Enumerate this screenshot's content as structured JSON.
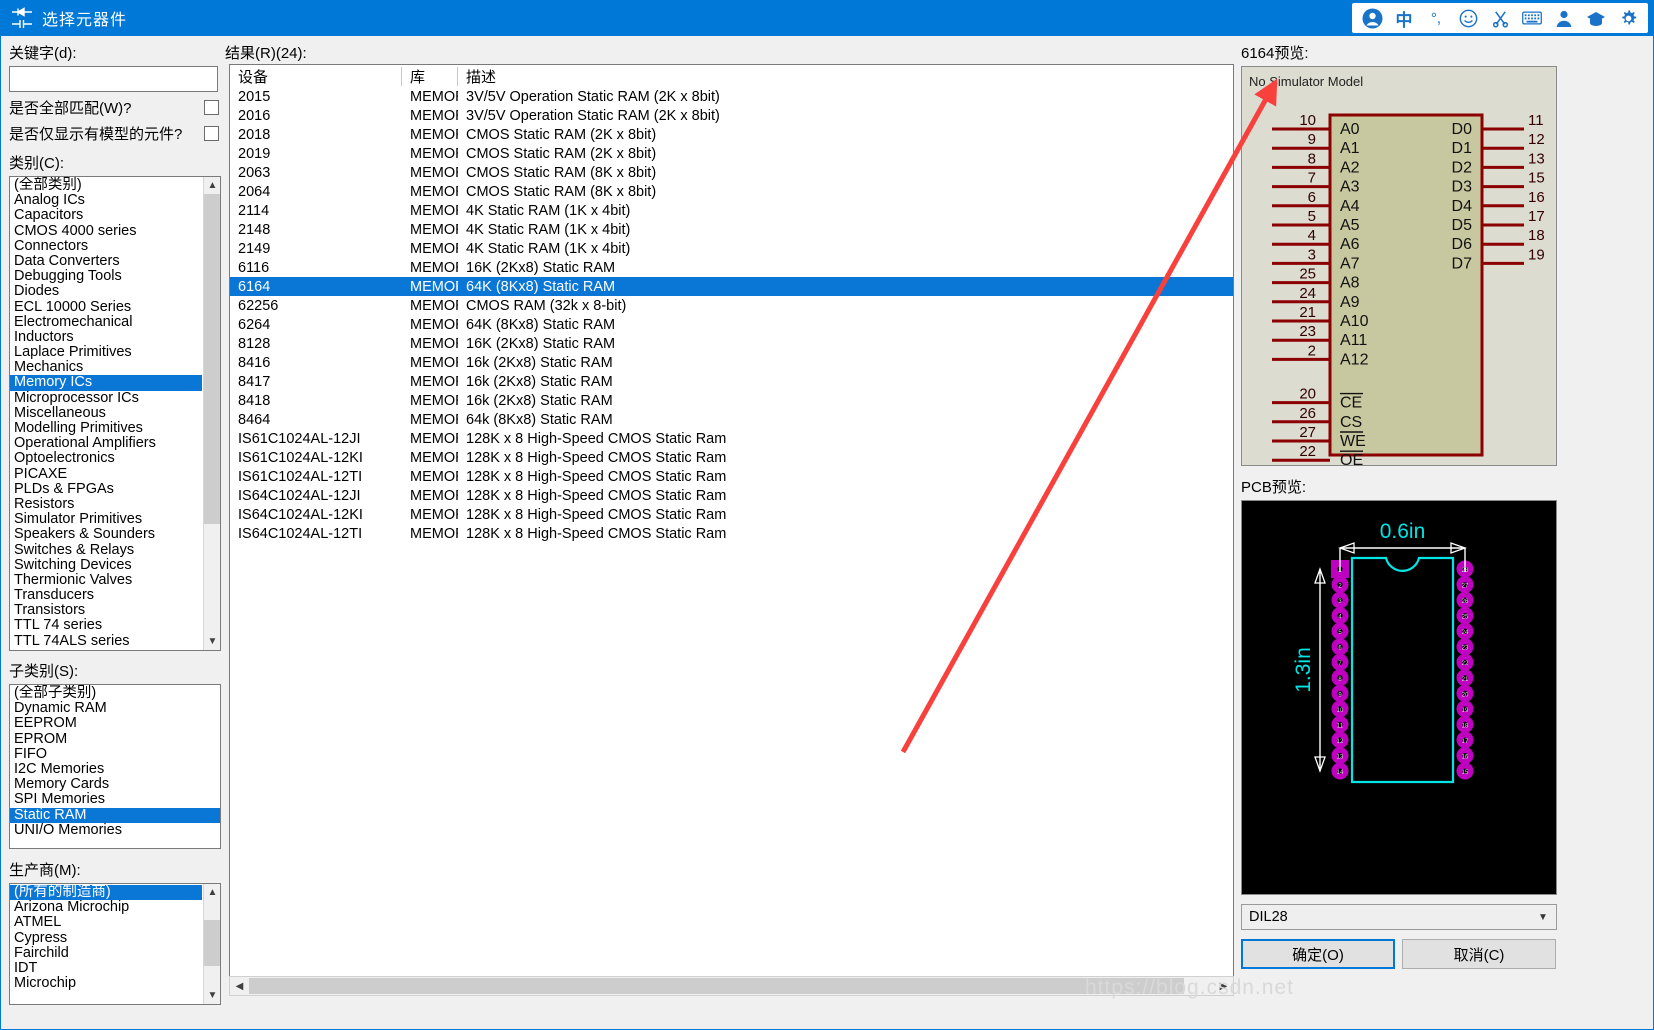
{
  "titlebar": {
    "title": "选择元器件",
    "app_icon": "component-icon",
    "ime_icons": [
      "user-avatar-icon",
      "chinese-input-icon",
      "punctuation-icon",
      "emoji-icon",
      "scissors-icon",
      "keyboard-icon",
      "person-icon",
      "hat-icon",
      "gear-icon"
    ],
    "accent_color": "#0078d7"
  },
  "left": {
    "keyword_label": "关键字(d):",
    "keyword_value": "",
    "keyword_placeholder": "",
    "match_all_label": "是否全部匹配(W)?",
    "match_all_checked": false,
    "only_modelled_label": "是否仅显示有模型的元件?",
    "only_modelled_checked": false,
    "category_label": "类别(C):",
    "categories": [
      "(全部类别)",
      "Analog ICs",
      "Capacitors",
      "CMOS 4000 series",
      "Connectors",
      "Data Converters",
      "Debugging Tools",
      "Diodes",
      "ECL 10000 Series",
      "Electromechanical",
      "Inductors",
      "Laplace Primitives",
      "Mechanics",
      "Memory ICs",
      "Microprocessor ICs",
      "Miscellaneous",
      "Modelling Primitives",
      "Operational Amplifiers",
      "Optoelectronics",
      "PICAXE",
      "PLDs & FPGAs",
      "Resistors",
      "Simulator Primitives",
      "Speakers & Sounders",
      "Switches & Relays",
      "Switching Devices",
      "Thermionic Valves",
      "Transducers",
      "Transistors",
      "TTL 74 series",
      "TTL 74ALS series"
    ],
    "category_selected": "Memory ICs",
    "subcategory_label": "子类别(S):",
    "subcategories": [
      "(全部子类别)",
      "Dynamic RAM",
      "EEPROM",
      "EPROM",
      "FIFO",
      "I2C Memories",
      "Memory Cards",
      "SPI Memories",
      "Static RAM",
      "UNI/O Memories"
    ],
    "subcategory_selected": "Static RAM",
    "manufacturer_label": "生产商(M):",
    "manufacturers": [
      "(所有的制造商)",
      "Arizona Microchip",
      "ATMEL",
      "Cypress",
      "Fairchild",
      "IDT",
      "Microchip"
    ],
    "manufacturer_selected": "(所有的制造商)"
  },
  "results": {
    "label": "结果(R)(24):",
    "count": 24,
    "columns": [
      "设备",
      "库",
      "描述"
    ],
    "selected_device": "6164",
    "rows": [
      {
        "device": "2015",
        "library": "MEMORY",
        "description": "3V/5V Operation Static RAM (2K x 8bit)"
      },
      {
        "device": "2016",
        "library": "MEMORY",
        "description": "3V/5V Operation Static RAM (2K x 8bit)"
      },
      {
        "device": "2018",
        "library": "MEMORY",
        "description": "CMOS Static RAM (2K x 8bit)"
      },
      {
        "device": "2019",
        "library": "MEMORY",
        "description": "CMOS Static RAM (2K x 8bit)"
      },
      {
        "device": "2063",
        "library": "MEMORY",
        "description": "CMOS Static RAM (8K x 8bit)"
      },
      {
        "device": "2064",
        "library": "MEMORY",
        "description": "CMOS Static RAM (8K x 8bit)"
      },
      {
        "device": "2114",
        "library": "MEMORY",
        "description": "4K Static RAM (1K x 4bit)"
      },
      {
        "device": "2148",
        "library": "MEMORY",
        "description": "4K Static RAM (1K x 4bit)"
      },
      {
        "device": "2149",
        "library": "MEMORY",
        "description": "4K Static RAM (1K x 4bit)"
      },
      {
        "device": "6116",
        "library": "MEMORY",
        "description": "16K (2Kx8) Static RAM"
      },
      {
        "device": "6164",
        "library": "MEMORY",
        "description": "64K (8Kx8) Static RAM"
      },
      {
        "device": "62256",
        "library": "MEMORY",
        "description": "CMOS RAM (32k x 8-bit)"
      },
      {
        "device": "6264",
        "library": "MEMORY",
        "description": "64K (8Kx8) Static RAM"
      },
      {
        "device": "8128",
        "library": "MEMORY",
        "description": "16K (2Kx8) Static RAM"
      },
      {
        "device": "8416",
        "library": "MEMORY",
        "description": "16k (2Kx8) Static RAM"
      },
      {
        "device": "8417",
        "library": "MEMORY",
        "description": "16k (2Kx8) Static RAM"
      },
      {
        "device": "8418",
        "library": "MEMORY",
        "description": "16k (2Kx8) Static RAM"
      },
      {
        "device": "8464",
        "library": "MEMORY",
        "description": "64k (8Kx8) Static RAM"
      },
      {
        "device": "IS61C1024AL-12JI",
        "library": "MEMORY",
        "description": "128K x 8 High-Speed CMOS Static Ram"
      },
      {
        "device": "IS61C1024AL-12KI",
        "library": "MEMORY",
        "description": "128K x 8 High-Speed CMOS Static Ram"
      },
      {
        "device": "IS61C1024AL-12TI",
        "library": "MEMORY",
        "description": "128K x 8 High-Speed CMOS Static Ram"
      },
      {
        "device": "IS64C1024AL-12JI",
        "library": "MEMORY",
        "description": "128K x 8 High-Speed CMOS Static Ram"
      },
      {
        "device": "IS64C1024AL-12KI",
        "library": "MEMORY",
        "description": "128K x 8 High-Speed CMOS Static Ram"
      },
      {
        "device": "IS64C1024AL-12TI",
        "library": "MEMORY",
        "description": "128K x 8 High-Speed CMOS Static Ram"
      }
    ]
  },
  "preview": {
    "schematic_label": "6164预览:",
    "no_model_text": "No Simulator Model",
    "left_pins": [
      {
        "num": "10",
        "name": "A0"
      },
      {
        "num": "9",
        "name": "A1"
      },
      {
        "num": "8",
        "name": "A2"
      },
      {
        "num": "7",
        "name": "A3"
      },
      {
        "num": "6",
        "name": "A4"
      },
      {
        "num": "5",
        "name": "A5"
      },
      {
        "num": "4",
        "name": "A6"
      },
      {
        "num": "3",
        "name": "A7"
      },
      {
        "num": "25",
        "name": "A8"
      },
      {
        "num": "24",
        "name": "A9"
      },
      {
        "num": "21",
        "name": "A10"
      },
      {
        "num": "23",
        "name": "A11"
      },
      {
        "num": "2",
        "name": "A12"
      }
    ],
    "control_pins": [
      {
        "num": "20",
        "name": "CE",
        "bar": true
      },
      {
        "num": "26",
        "name": "CS",
        "bar": false
      },
      {
        "num": "27",
        "name": "WE",
        "bar": true
      },
      {
        "num": "22",
        "name": "OE",
        "bar": true
      }
    ],
    "right_pins": [
      {
        "num": "11",
        "name": "D0"
      },
      {
        "num": "12",
        "name": "D1"
      },
      {
        "num": "13",
        "name": "D2"
      },
      {
        "num": "15",
        "name": "D3"
      },
      {
        "num": "16",
        "name": "D4"
      },
      {
        "num": "17",
        "name": "D5"
      },
      {
        "num": "18",
        "name": "D6"
      },
      {
        "num": "19",
        "name": "D7"
      }
    ],
    "body_color": "#c8c8a0",
    "outline_color": "#8b0000",
    "pcb_label": "PCB预览:",
    "pcb_width_dim": "0.6in",
    "pcb_height_dim": "1.3in",
    "pcb_pin_count": 28,
    "pcb_trace_color": "#00e5e5",
    "pcb_pad_color": "#c000c0",
    "package_value": "DIL28"
  },
  "buttons": {
    "ok": "确定(O)",
    "cancel": "取消(C)"
  },
  "watermark": "https://blog.csdn.net"
}
